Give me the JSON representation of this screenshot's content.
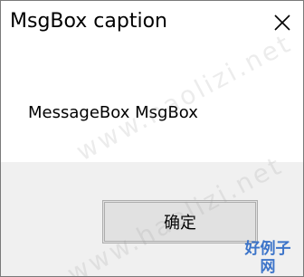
{
  "window": {
    "title": "MsgBox caption",
    "message": "MessageBox MsgBox",
    "ok_label": "确定"
  },
  "watermarks": [
    "www.haolizi.net",
    "www.haolizi.net"
  ],
  "site_logo": {
    "text": "好例子网"
  },
  "colors": {
    "dialog_background": "#ffffff",
    "footer_background": "#f0f0f0",
    "button_face": "#e1e1e1",
    "button_border": "#adadad",
    "logo_blue": "#3c74c9"
  },
  "icons": {
    "close": "close-icon"
  }
}
